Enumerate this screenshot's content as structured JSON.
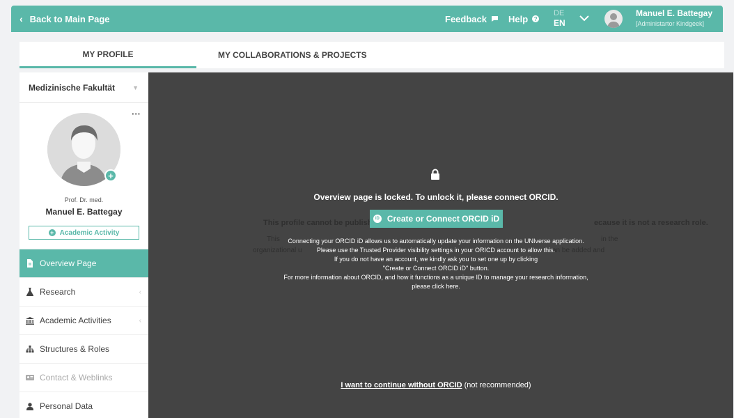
{
  "header": {
    "back_label": "Back to Main Page",
    "feedback_label": "Feedback",
    "help_label": "Help",
    "lang_de": "DE",
    "lang_en": "EN",
    "user_name": "Manuel E. Battegay",
    "user_role": "[Administartor Kindgeek]"
  },
  "tabs": [
    {
      "label": "MY PROFILE",
      "active": true
    },
    {
      "label": "MY COLLABORATIONS & PROJECTS",
      "active": false
    }
  ],
  "sidebar": {
    "faculty": "Medizinische Fakultät",
    "profile": {
      "title": "Prof. Dr. med.",
      "name": "Manuel E. Battegay",
      "academic_button": "Academic Activity"
    },
    "items": [
      {
        "label": "Overview Page",
        "icon": "document-icon",
        "active": true
      },
      {
        "label": "Research",
        "icon": "flask-icon"
      },
      {
        "label": "Academic Activities",
        "icon": "institution-icon"
      },
      {
        "label": "Structures & Roles",
        "icon": "sitemap-icon"
      },
      {
        "label": "Contact & Weblinks",
        "icon": "address-card-icon",
        "disabled": true
      },
      {
        "label": "Personal Data",
        "icon": "user-icon"
      }
    ]
  },
  "main": {
    "background_text": {
      "line1_left": "This profile cannot be publishe",
      "line1_right": "ecause it is not a research role.",
      "line2_left": "This",
      "line2_right": "in the",
      "line3_left": "organizational u",
      "line3_right": "an be added and"
    },
    "locked_message": "Overview page is locked. To unlock it, please connect ORCID.",
    "orcid_button": "Create or Connect ORCID iD",
    "info_lines": [
      "Connecting your ORCID iD allows us to automatically update your information on the UNIverse application.",
      "Please use the Trusted Provider visibility settings in your ORICD account to allow this.",
      "If you do not have an account, we kindly ask you to set one up by clicking",
      "\"Create or Connect ORCID iD\" button.",
      "For more information about ORCID, and how it functions as a unique ID to manage your research information,",
      "please click here."
    ],
    "continue_link": "I want to continue without ORCID",
    "continue_suffix": " (not recommended)"
  },
  "colors": {
    "accent": "#5ab8a9",
    "overlay": "#444444"
  }
}
